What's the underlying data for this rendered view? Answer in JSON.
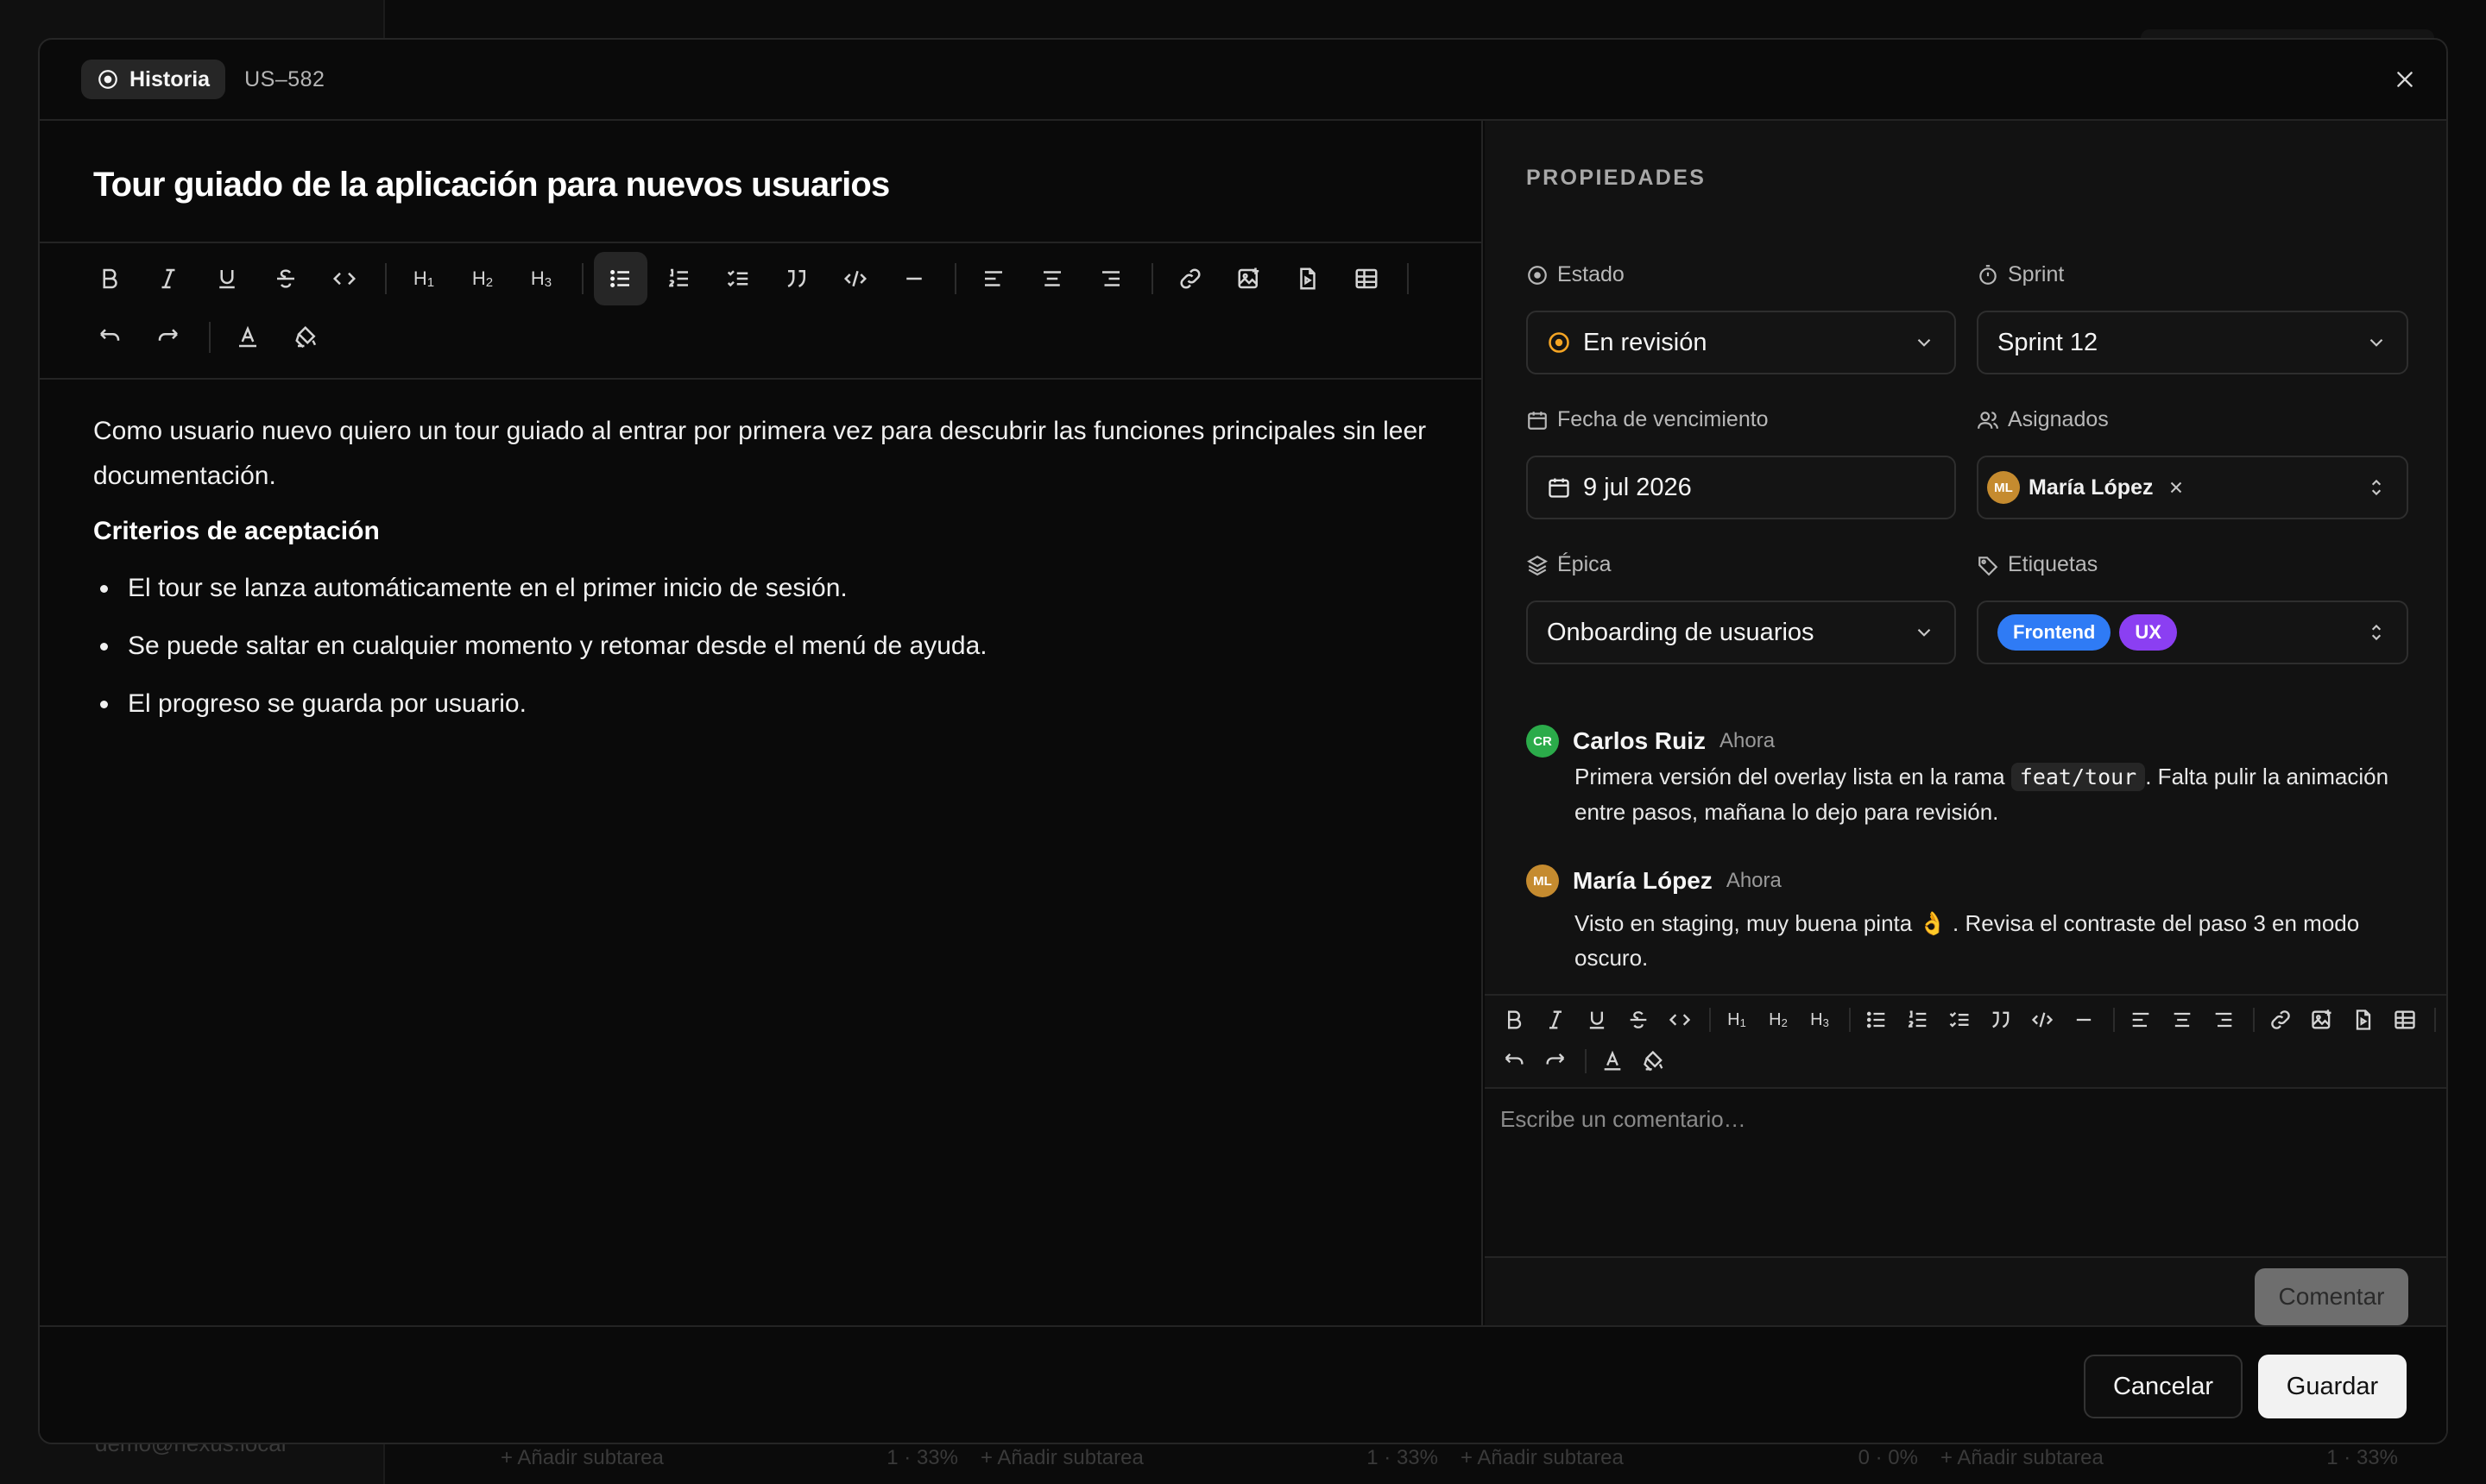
{
  "background": {
    "email": "demo@nexus.local",
    "subtask_rows": [
      {
        "label": "Añadir subtarea",
        "progress": "1 · 33%"
      },
      {
        "label": "Añadir subtarea",
        "progress": "1 · 33%"
      },
      {
        "label": "Añadir subtarea",
        "progress": "0 · 0%"
      },
      {
        "label": "Añadir subtarea",
        "progress": "1 · 33%"
      }
    ]
  },
  "modal": {
    "type_label": "Historia",
    "issue_key": "US–582",
    "title": "Tour guiado de la aplicación para nuevos usuarios",
    "editor": {
      "toolbar_icons": [
        "bold-icon",
        "italic-icon",
        "underline-icon",
        "strikethrough-icon",
        "code-icon",
        "heading-1",
        "heading-2",
        "heading-3",
        "bullet-list-icon",
        "ordered-list-icon",
        "checklist-icon",
        "quote-icon",
        "code-block-icon",
        "horizontal-rule-icon",
        "align-left-icon",
        "align-center-icon",
        "align-right-icon",
        "link-icon",
        "image-icon",
        "file-icon",
        "table-icon",
        "undo-icon",
        "redo-icon",
        "text-color-icon",
        "highlight-icon"
      ],
      "heading_labels": {
        "h1": "H",
        "h2": "H",
        "h3": "H",
        "h1_sub": "1",
        "h2_sub": "2",
        "h3_sub": "3"
      },
      "active_tool": "bullet-list",
      "paragraph": "Como usuario nuevo quiero un tour guiado al entrar por primera vez para descubrir las funciones principales sin leer documentación.",
      "criteria_heading": "Criterios de aceptación",
      "criteria": [
        "El tour se lanza automáticamente en el primer inicio de sesión.",
        "Se puede saltar en cualquier momento y retomar desde el menú de ayuda.",
        "El progreso se guarda por usuario."
      ]
    },
    "properties": {
      "title": "PROPIEDADES",
      "estado": {
        "label": "Estado",
        "value": "En revisión",
        "color": "#f5a524"
      },
      "sprint": {
        "label": "Sprint",
        "value": "Sprint 12"
      },
      "due": {
        "label": "Fecha de vencimiento",
        "value": "9 jul 2026"
      },
      "assignees": {
        "label": "Asignados",
        "initials": "ML",
        "name": "María López"
      },
      "epic": {
        "label": "Épica",
        "value": "Onboarding de usuarios"
      },
      "tags": {
        "label": "Etiquetas",
        "items": [
          {
            "name": "Frontend",
            "color": "#2f7bf5"
          },
          {
            "name": "UX",
            "color": "#8b3ff2"
          }
        ]
      }
    },
    "comments": [
      {
        "initials": "CR",
        "author": "Carlos Ruiz",
        "time": "Ahora",
        "text_before": "Primera versión del overlay lista en la rama ",
        "code": "feat/tour",
        "text_after": ". Falta pulir la animación entre pasos, mañana lo dejo para revisión.",
        "avatar_color": "#2bab4a"
      },
      {
        "initials": "ML",
        "author": "María López",
        "time": "Ahora",
        "text": "Visto en staging, muy buena pinta 👌 . Revisa el contraste del paso 3 en modo oscuro.",
        "avatar_color": "#c58b2f"
      }
    ],
    "comment_box": {
      "placeholder": "Escribe un comentario…",
      "submit_label": "Comentar"
    },
    "footer": {
      "cancel_label": "Cancelar",
      "save_label": "Guardar"
    }
  }
}
